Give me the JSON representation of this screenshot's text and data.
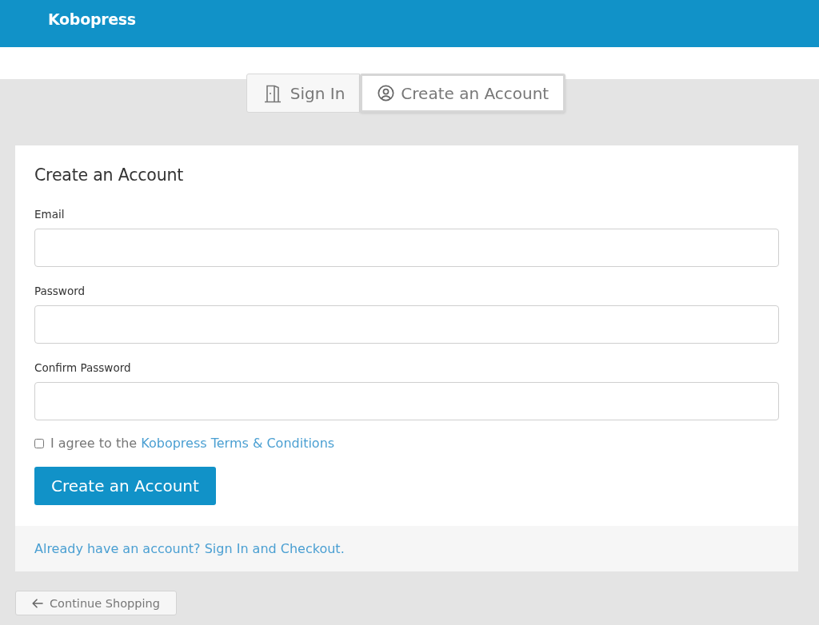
{
  "header": {
    "brand": "Kobopress"
  },
  "tabs": [
    {
      "label": "Sign In",
      "kind": "sign_in",
      "selected": false
    },
    {
      "label": "Create an Account",
      "kind": "register",
      "selected": true
    }
  ],
  "form": {
    "title": "Create an Account",
    "fields": [
      {
        "label": "Email"
      },
      {
        "label": "Password"
      },
      {
        "label": "Confirm Password"
      }
    ],
    "agree": {
      "text": "I agree to the",
      "link": "Kobopress Terms & Conditions",
      "checked": false
    },
    "submit": "Create an Account"
  },
  "footer": {
    "link": "Already have an account? Sign In and Checkout."
  },
  "continue_button": "Continue Shopping"
}
